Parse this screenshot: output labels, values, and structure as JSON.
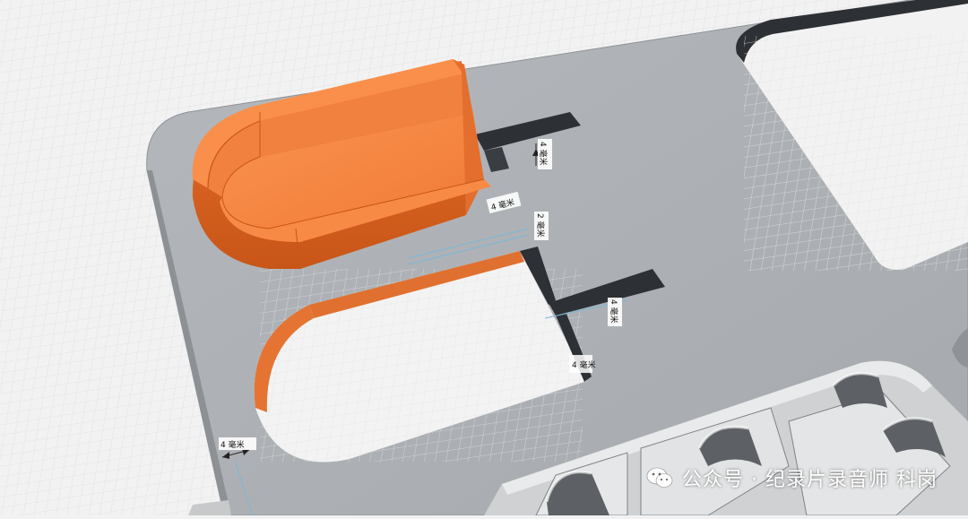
{
  "viewport": {
    "background_color": "#f2f2f2",
    "grid_color": "#d9dde1",
    "plate_color": "#aeb2b6",
    "orange_part_color": "#f4823f",
    "pocket_wall_color": "#2d3034"
  },
  "dimensions": {
    "d1": "4 毫米",
    "d2": "4 毫米",
    "d3": "2 毫米",
    "d4": "4 毫米",
    "d5": "4 毫米",
    "d6": "4 毫米"
  },
  "watermark": {
    "text": "公众号 · 纪录片录音师 科岗",
    "icon": "wechat-icon"
  }
}
